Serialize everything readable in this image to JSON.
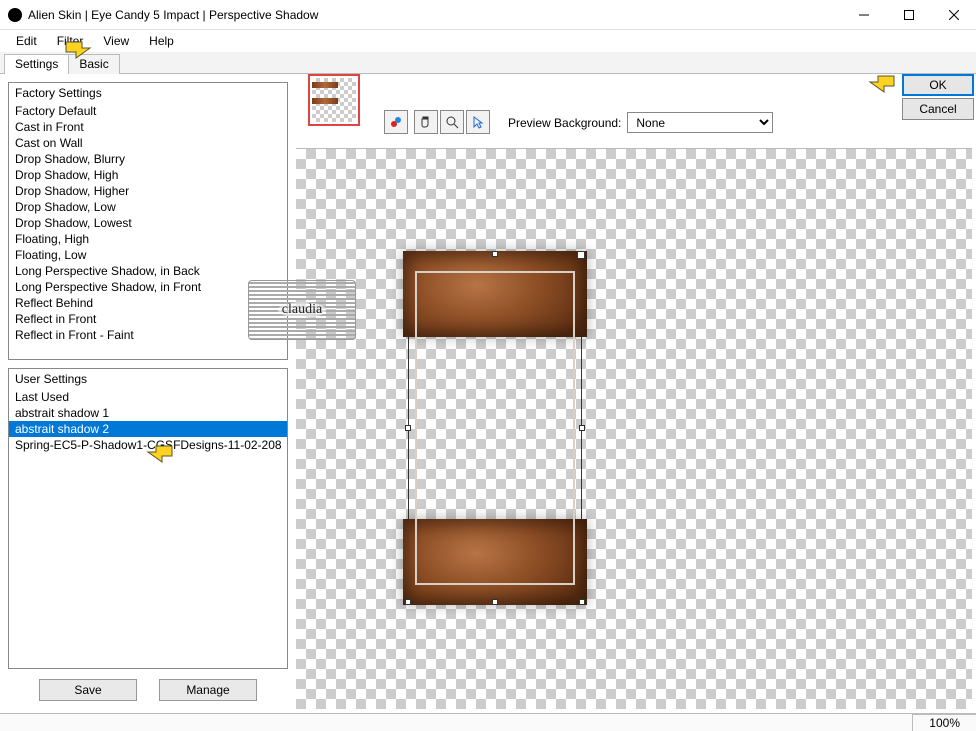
{
  "window": {
    "title": "Alien Skin | Eye Candy 5 Impact | Perspective Shadow"
  },
  "menu": {
    "edit": "Edit",
    "filter": "Filter",
    "view": "View",
    "help": "Help"
  },
  "tabs": {
    "settings": "Settings",
    "basic": "Basic"
  },
  "factory": {
    "header": "Factory Settings",
    "items": [
      "Factory Default",
      "Cast in Front",
      "Cast on Wall",
      "Drop Shadow, Blurry",
      "Drop Shadow, High",
      "Drop Shadow, Higher",
      "Drop Shadow, Low",
      "Drop Shadow, Lowest",
      "Floating, High",
      "Floating, Low",
      "Long Perspective Shadow, in Back",
      "Long Perspective Shadow, in Front",
      "Reflect Behind",
      "Reflect in Front",
      "Reflect in Front - Faint"
    ]
  },
  "user": {
    "header": "User Settings",
    "items": [
      "Last Used",
      "abstrait shadow 1",
      "abstrait shadow 2",
      "Spring-EC5-P-Shadow1-CGSFDesigns-11-02-208"
    ],
    "selected_index": 2
  },
  "buttons": {
    "save": "Save",
    "manage": "Manage",
    "ok": "OK",
    "cancel": "Cancel"
  },
  "preview": {
    "bg_label": "Preview Background:",
    "bg_value": "None",
    "zoom": "100%"
  },
  "watermark": "claudia"
}
